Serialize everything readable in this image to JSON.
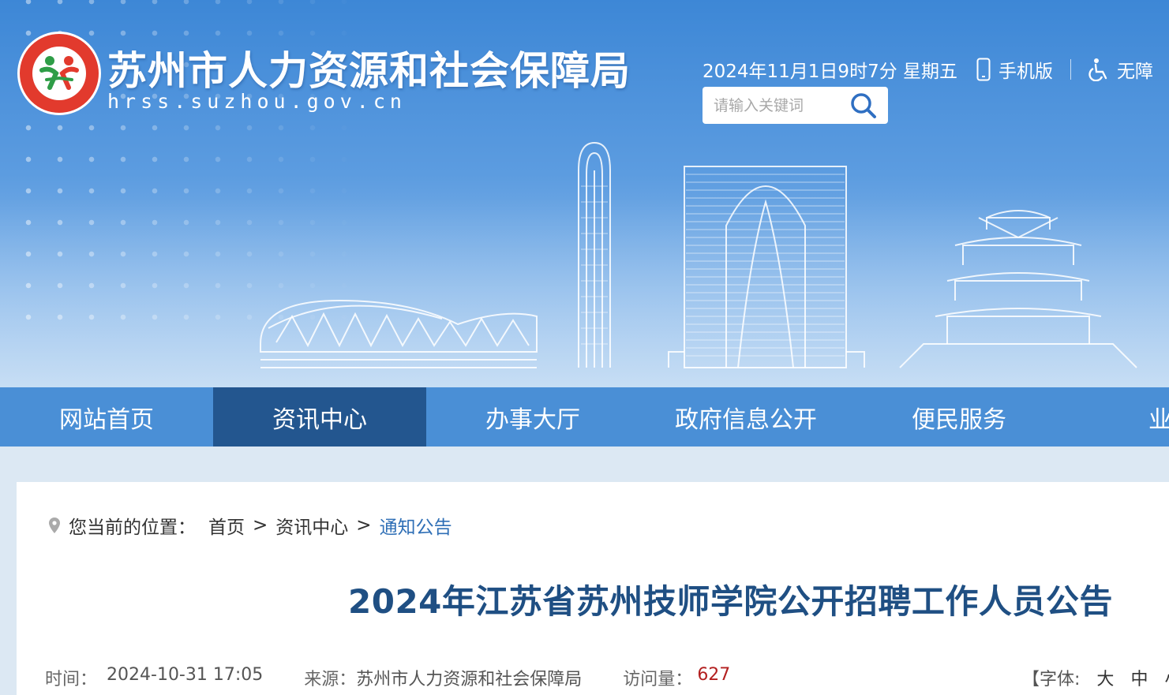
{
  "header": {
    "site_name": "苏州市人力资源和社会保障局",
    "domain": "hrss.suzhou.gov.cn",
    "datetime": "2024年11月1日9时7分 星期五",
    "mobile_label": "手机版",
    "accessibility_label": "无障",
    "search_placeholder": "请输入关键词"
  },
  "nav": {
    "items": [
      {
        "label": "网站首页",
        "active": false
      },
      {
        "label": "资讯中心",
        "active": true
      },
      {
        "label": "办事大厅",
        "active": false
      },
      {
        "label": "政府信息公开",
        "active": false
      },
      {
        "label": "便民服务",
        "active": false
      },
      {
        "label": "业务",
        "active": false
      }
    ]
  },
  "breadcrumb": {
    "prefix": "您当前的位置：",
    "items": [
      "首页",
      "资讯中心",
      "通知公告"
    ],
    "separator": ">"
  },
  "article": {
    "title": "2024年江苏省苏州技师学院公开招聘工作人员公告",
    "time_label": "时间：",
    "time_value": "2024-10-31 17:05",
    "source_label": "来源：",
    "source_value": "苏州市人力资源和社会保障局",
    "views_label": "访问量：",
    "views_value": "627",
    "font_label": "【字体:",
    "font_large": "大",
    "font_medium": "中",
    "font_small": "小"
  },
  "colors": {
    "nav_bg": "#4a8fd6",
    "nav_active": "#23568f",
    "title": "#1f4f83",
    "link": "#2f6fb6",
    "views": "#b32020"
  }
}
